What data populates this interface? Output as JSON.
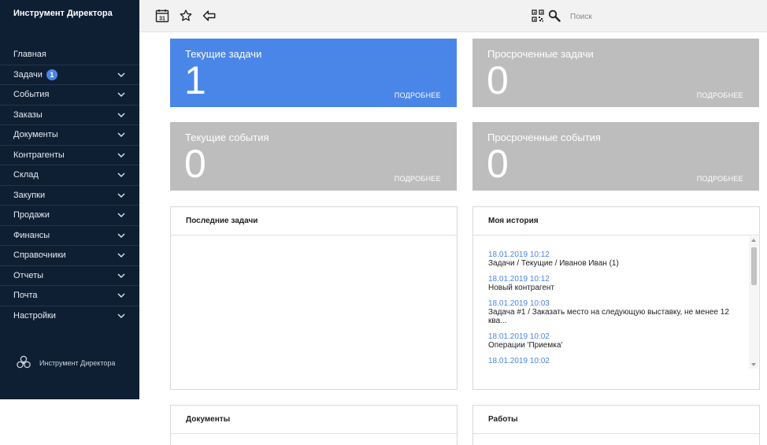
{
  "app": {
    "title": "Инструмент Директора"
  },
  "sidebar": {
    "items": [
      {
        "label": "Главная",
        "expandable": false
      },
      {
        "label": "Задачи",
        "badge": "1",
        "expandable": true
      },
      {
        "label": "События",
        "expandable": true
      },
      {
        "label": "Заказы",
        "expandable": true
      },
      {
        "label": "Документы",
        "expandable": true
      },
      {
        "label": "Контрагенты",
        "expandable": true
      },
      {
        "label": "Склад",
        "expandable": true
      },
      {
        "label": "Закупки",
        "expandable": true
      },
      {
        "label": "Продажи",
        "expandable": true
      },
      {
        "label": "Финансы",
        "expandable": true
      },
      {
        "label": "Справочники",
        "expandable": true
      },
      {
        "label": "Отчеты",
        "expandable": true
      },
      {
        "label": "Почта",
        "expandable": true
      },
      {
        "label": "Настройки",
        "expandable": true
      }
    ],
    "footer_label": "Инструмент Директора",
    "footer_icon": "biohazard-like-logo-icon"
  },
  "topbar": {
    "icons": [
      "calendar-icon",
      "star-icon",
      "back-arrow-icon",
      "qr-code-icon",
      "search-icon"
    ],
    "calendar_day": "31",
    "search_placeholder": "Поиск"
  },
  "cards": {
    "current_tasks": {
      "title": "Текущие задачи",
      "value": "1",
      "more": "ПОДРОБНЕЕ",
      "color": "#4a86e8"
    },
    "overdue_tasks": {
      "title": "Просроченные задачи",
      "value": "0",
      "more": "ПОДРОБНЕЕ",
      "color": "#bdbdbd"
    },
    "current_events": {
      "title": "Текущие события",
      "value": "0",
      "more": "ПОДРОБНЕЕ",
      "color": "#bdbdbd"
    },
    "overdue_events": {
      "title": "Просроченные события",
      "value": "0",
      "more": "ПОДРОБНЕЕ",
      "color": "#bdbdbd"
    }
  },
  "panels": {
    "recent_tasks": {
      "title": "Последние задачи"
    },
    "my_history": {
      "title": "Моя история",
      "items": [
        {
          "date": "18.01.2019 10:12",
          "text": "Задачи / Текущие / Иванов Иван (1)"
        },
        {
          "date": "18.01.2019 10:12",
          "text": "Новый контрагент"
        },
        {
          "date": "18.01.2019 10:03",
          "text": "Задача #1 / Заказать место на следующую выставку, не менее 12 ква..."
        },
        {
          "date": "18.01.2019 10:02",
          "text": "Операции 'Приемка'"
        },
        {
          "date": "18.01.2019 10:02",
          "text": ""
        }
      ]
    },
    "documents": {
      "title": "Документы"
    },
    "works": {
      "title": "Работы"
    }
  }
}
